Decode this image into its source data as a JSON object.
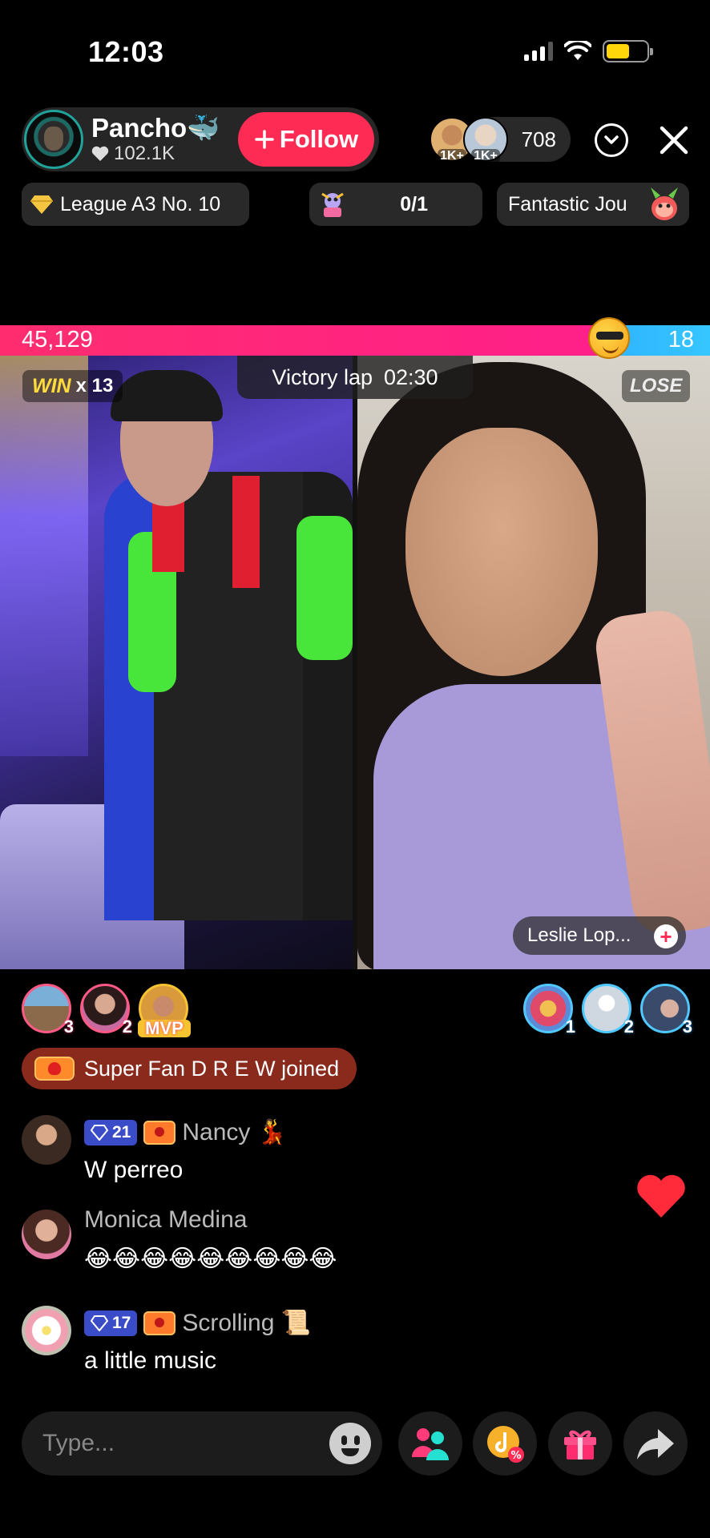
{
  "status_bar": {
    "time": "12:03"
  },
  "host": {
    "name": "Pancho🐳",
    "likes": "102.1K",
    "follow_label": "Follow"
  },
  "viewers": {
    "avatar_badges": [
      "1K+",
      "1K+"
    ],
    "count": "708"
  },
  "pills": {
    "league": "League A3 No. 10",
    "goal": "0/1",
    "journey": "Fantastic Jou"
  },
  "battle": {
    "left_score": "45,129",
    "right_score": "18",
    "left_share": 0.858,
    "win_word": "WIN",
    "win_count": "x 13",
    "victory_label": "Victory lap",
    "timer": "02:30",
    "lose_label": "LOSE",
    "opponent_name": "Leslie Lop..."
  },
  "supporters_left": [
    {
      "rank": "3"
    },
    {
      "rank": "2"
    },
    {
      "rank": "MVP"
    }
  ],
  "supporters_right": [
    {
      "rank": "1"
    },
    {
      "rank": "2"
    },
    {
      "rank": "3"
    }
  ],
  "join_banner": "Super Fan D R E W joined",
  "comments": [
    {
      "level": "21",
      "name": "Nancy 💃",
      "text": "W perreo"
    },
    {
      "level": "",
      "name": "Monica Medina",
      "text": "😂😂😂😂😂😂😂😂😂"
    },
    {
      "level": "17",
      "name": "Scrolling 📜",
      "text": "a little music"
    }
  ],
  "input": {
    "placeholder": "Type..."
  },
  "colors": {
    "accent": "#fe2c55",
    "left_team": "#ff2d6f",
    "right_team": "#36c6ff"
  },
  "icons": [
    "signal-icon",
    "wifi-icon",
    "battery-icon",
    "heart-icon",
    "plus-icon",
    "chevron-down-icon",
    "close-icon",
    "diamond-icon",
    "heart-float-icon",
    "emoji-icon",
    "multi-guest-icon",
    "tiktok-coin-icon",
    "gift-icon",
    "share-icon"
  ]
}
